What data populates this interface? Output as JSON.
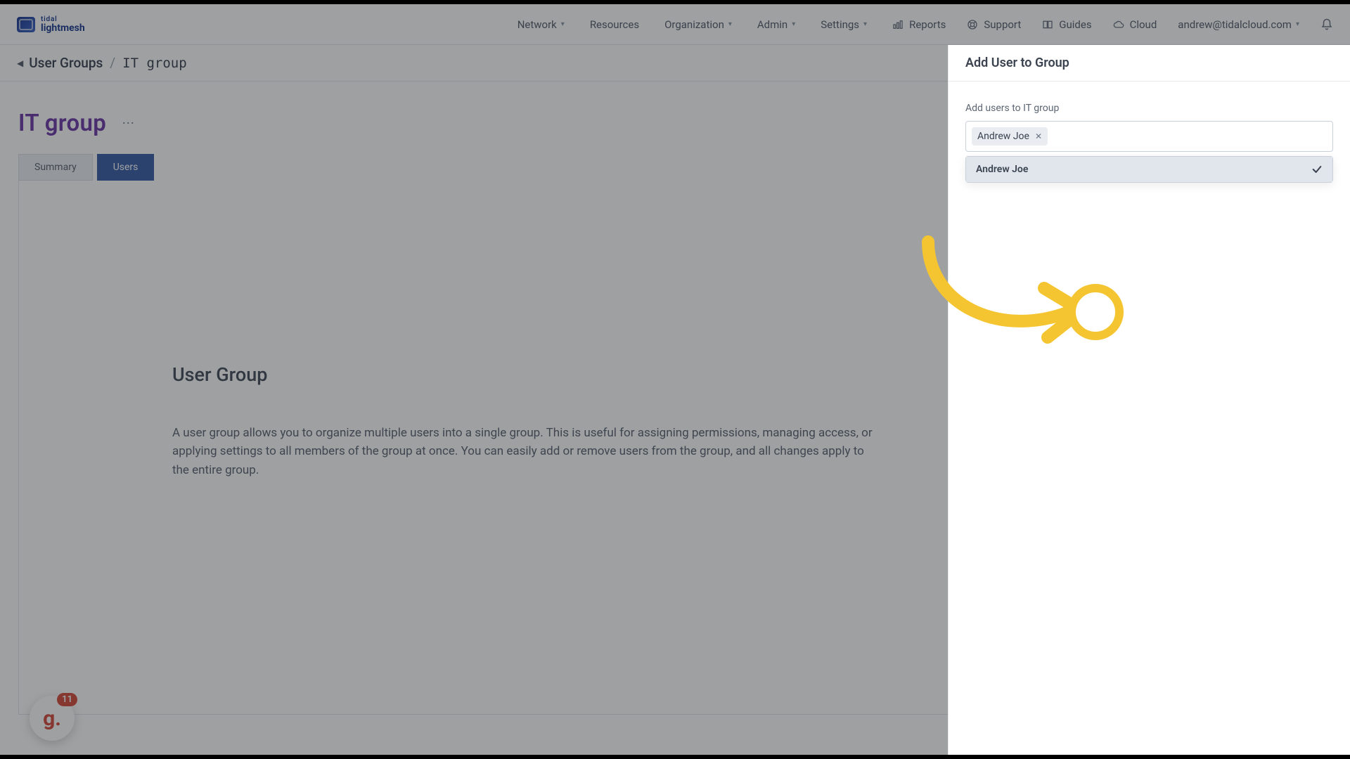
{
  "brand": {
    "line1": "tidal",
    "line2": "lightmesh"
  },
  "nav": {
    "items": [
      "Network",
      "Resources",
      "Organization",
      "Admin",
      "Settings"
    ],
    "links": {
      "reports": "Reports",
      "support": "Support",
      "guides": "Guides",
      "cloud": "Cloud"
    },
    "user_email": "andrew@tidalcloud.com"
  },
  "breadcrumb": {
    "parent": "User Groups",
    "current": "IT group"
  },
  "page": {
    "title": "IT group",
    "tabs": {
      "summary": "Summary",
      "users": "Users"
    },
    "content": {
      "heading": "User Group",
      "body": "A user group allows you to organize multiple users into a single group. This is useful for assigning permissions, managing access, or applying settings to all members of the group at once. You can easily add or remove users from the group, and all changes apply to the entire group."
    }
  },
  "help_fab": {
    "glyph": "g.",
    "badge": "11"
  },
  "sidepanel": {
    "title": "Add User to Group",
    "field_label": "Add users to IT group",
    "selected_chips": [
      "Andrew Joe"
    ],
    "dropdown_options": [
      {
        "label": "Andrew Joe",
        "selected": true
      }
    ]
  }
}
